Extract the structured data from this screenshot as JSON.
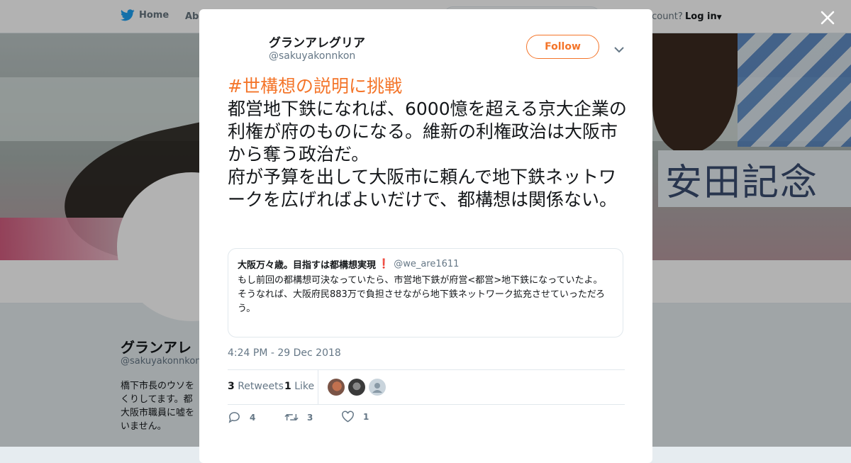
{
  "topbar": {
    "home_label": "Home",
    "about_label": "Abo",
    "account_prompt": "ccount?",
    "login_label": "Log in"
  },
  "banner": {
    "sign_text": "安田記念"
  },
  "profile": {
    "name": "グランアレ",
    "handle": "@sakuyakonnkon",
    "bio_lines": [
      "橋下市長のウソを",
      "くりしてます。都",
      "大阪市職員に嘘を",
      "いません。"
    ]
  },
  "tweet": {
    "author_name": "グランアレグリア",
    "author_handle": "@sakuyakonnkon",
    "follow_label": "Follow",
    "hashtag": "#世構想の説明に挑戦",
    "paragraph_1": "都営地下鉄になれば、6000憶を超える京大企業の利権が府のものになる。維新の利権政治は大阪市から奪う政治だ。",
    "paragraph_2": "府が予算を出して大阪市に頼んで地下鉄ネットワークを広げればよいだけで、都構想は関係ない。",
    "quote": {
      "name": "大阪万々歳。目指すは都構想実現",
      "mark": "❗",
      "handle": "@we_are1611",
      "line_1": "もし前回の都構想可決なっていたら、市営地下鉄が府営<都営>地下鉄になっていたよ。",
      "line_2": "そうなれば、大阪府民883万で負担させながら地下鉄ネットワーク拡充させていっただろう。"
    },
    "timestamp": "4:24 PM - 29 Dec 2018",
    "retweet_count": "3",
    "retweet_label": "Retweets",
    "like_count": "1",
    "like_label": "Like",
    "actions": {
      "reply": "4",
      "retweet": "3",
      "like": "1"
    }
  },
  "colors": {
    "accent": "#f4752a",
    "twitter_blue": "#1da1f2",
    "muted": "#657786"
  }
}
